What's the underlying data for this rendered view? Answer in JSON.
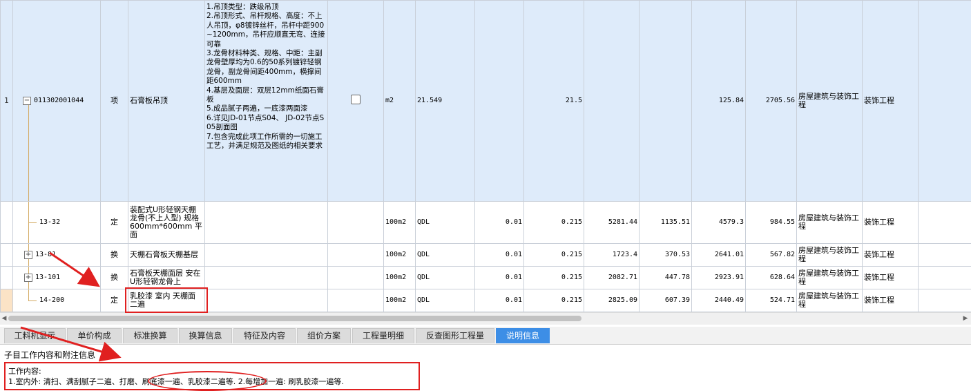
{
  "rows": [
    {
      "rownum": "1",
      "code": "011302001044",
      "category": "项",
      "name": "石膏板吊顶",
      "description": "1.吊顶类型：跌级吊顶\n2.吊顶形式、吊杆规格、高度：不上人吊顶，φ8镀锌丝杆，吊杆中距900~1200mm，吊杆应顺直无弯、连接可靠\n3.龙骨材料种类、规格、中距：主副龙骨壁厚均为0.6的50系列镀锌轻钢龙骨，副龙骨间距400mm，横撑间距600mm\n4.基层及面层：双层12mm纸面石膏板\n5.成品腻子两遍，一底漆两面漆\n6.详见JD-01节点S04、 JD-02节点S05剖面图\n7.包含完成此项工作所需的一切施工工艺，并满足规范及图纸的相关要求",
      "unit": "m2",
      "expr": "21.549",
      "coef": "",
      "qty": "21.5",
      "price1": "",
      "price2": "",
      "price3": "125.84",
      "total": "2705.56",
      "major": "房屋建筑与装饰工程",
      "sub": "装饰工程"
    },
    {
      "rownum": "",
      "code": "13-32",
      "category": "定",
      "name": "装配式U形轻钢天棚龙骨(不上人型) 规格600mm*600mm 平面",
      "description": "",
      "unit": "100m2",
      "expr": "QDL",
      "coef": "0.01",
      "qty": "0.215",
      "price1": "5281.44",
      "price2": "1135.51",
      "price3": "4579.3",
      "total": "984.55",
      "major": "房屋建筑与装饰工程",
      "sub": "装饰工程"
    },
    {
      "rownum": "",
      "code": "13-81",
      "category": "换",
      "name": "天棚石膏板天棚基层",
      "description": "",
      "unit": "100m2",
      "expr": "QDL",
      "coef": "0.01",
      "qty": "0.215",
      "price1": "1723.4",
      "price2": "370.53",
      "price3": "2641.01",
      "total": "567.82",
      "major": "房屋建筑与装饰工程",
      "sub": "装饰工程"
    },
    {
      "rownum": "",
      "code": "13-101",
      "category": "换",
      "name": "石膏板天棚面层 安在U形轻钢龙骨上",
      "description": "",
      "unit": "100m2",
      "expr": "QDL",
      "coef": "0.01",
      "qty": "0.215",
      "price1": "2082.71",
      "price2": "447.78",
      "price3": "2923.91",
      "total": "628.64",
      "major": "房屋建筑与装饰工程",
      "sub": "装饰工程"
    },
    {
      "rownum": "",
      "code": "14-200",
      "category": "定",
      "name": "乳胶漆 室内 天棚面 二遍",
      "description": "",
      "unit": "100m2",
      "expr": "QDL",
      "coef": "0.01",
      "qty": "0.215",
      "price1": "2825.09",
      "price2": "607.39",
      "price3": "2440.49",
      "total": "524.71",
      "major": "房屋建筑与装饰工程",
      "sub": "装饰工程"
    }
  ],
  "tree": {
    "collapse_glyph": "−",
    "expand_glyph": "+"
  },
  "tabs": [
    {
      "label": "工料机显示",
      "active": false
    },
    {
      "label": "单价构成",
      "active": false
    },
    {
      "label": "标准换算",
      "active": false
    },
    {
      "label": "换算信息",
      "active": false
    },
    {
      "label": "特征及内容",
      "active": false
    },
    {
      "label": "组价方案",
      "active": false
    },
    {
      "label": "工程量明细",
      "active": false
    },
    {
      "label": "反查图形工程量",
      "active": false
    },
    {
      "label": "说明信息",
      "active": true
    }
  ],
  "panel": {
    "subtitle": "子目工作内容和附注信息",
    "work_label": "工作内容:",
    "work_text": "1.室内外: 清扫、满刮腻子二遍、打磨、刷底漆一遍、乳胶漆二遍等. 2.每增加一遍: 刷乳胶漆一遍等."
  },
  "scroll": {
    "left_arrow": "◀",
    "right_arrow": "▶"
  },
  "colors": {
    "selected_row": "#deebfa",
    "active_tab": "#3d8ee6",
    "annotation": "#e02020",
    "tree_line": "#d3a960"
  },
  "icons": [
    "collapse-icon",
    "expand-icon",
    "checkbox-icon",
    "scroll-left-icon",
    "scroll-right-icon"
  ]
}
